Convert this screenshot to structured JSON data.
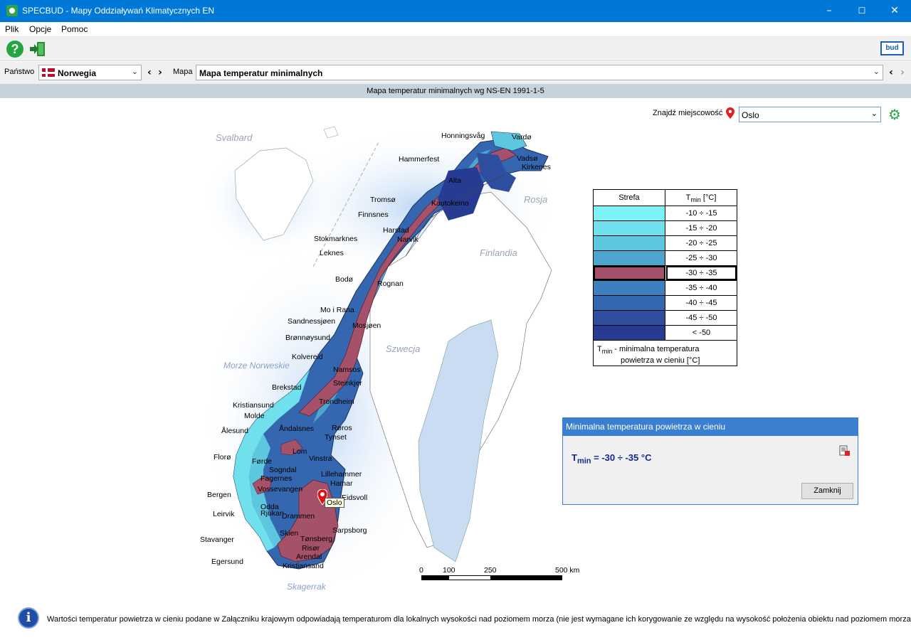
{
  "window": {
    "title": "SPECBUD - Mapy Oddziaływań Klimatycznych EN",
    "minimize": "–",
    "maximize": "☐",
    "close": "✕"
  },
  "menu": [
    "Plik",
    "Opcje",
    "Pomoc"
  ],
  "toolbar": {
    "help": "?",
    "logo": "bud"
  },
  "selection": {
    "country_label": "Państwo",
    "country_value": "Norwegia",
    "map_label": "Mapa",
    "map_value": "Mapa temperatur minimalnych",
    "prev": "‹",
    "next": "›"
  },
  "caption": "Mapa temperatur minimalnych wg NS-EN 1991-1-5",
  "find": {
    "label": "Znajdź miejscowość",
    "value": "Oslo"
  },
  "regions": {
    "svalbard": "Svalbard",
    "rosja": "Rosja",
    "finlandia": "Finlandia",
    "szwecja": "Szwecja",
    "morze": "Morze Norweskie",
    "skagerrak": "Skagerrak"
  },
  "cities": {
    "honningsvag": "Honningsvåg",
    "vardo": "Vardø",
    "hammerfest": "Hammerfest",
    "vadso": "Vadsø",
    "kirkenes": "Kirkenes",
    "alta": "Alta",
    "tromso": "Tromsø",
    "kautokeino": "Kautokeino",
    "finnsnes": "Finnsnes",
    "harstad": "Harstad",
    "stokmarknes": "Stokmarknes",
    "narvik": "Narvik",
    "leknes": "Leknes",
    "bodo": "Bodø",
    "rognan": "Rognan",
    "moirana": "Mo i Rana",
    "sandnessjoen": "Sandnessjøen",
    "mosjoen": "Mosjøen",
    "bronnoysund": "Brønnøysund",
    "kolvereid": "Kolvereid",
    "namsos": "Namsos",
    "brekstad": "Brekstad",
    "steinkjer": "Steinkjer",
    "trondheim": "Trondheim",
    "kristiansund": "Kristiansund",
    "molde": "Molde",
    "roros": "Røros",
    "alesund": "Ålesund",
    "andalsnes": "Åndalsnes",
    "tynset": "Tynset",
    "lom": "Lom",
    "floro": "Florø",
    "forde": "Førde",
    "vinstra": "Vinstra",
    "sogndal": "Sogndal",
    "fagernes": "Fagernes",
    "lillehammer": "Lillehammer",
    "hamar": "Hamar",
    "bergen": "Bergen",
    "vossevangen": "Vossevangen",
    "eidsvoll": "Eidsvoll",
    "odda": "Odda",
    "rjukan": "Rjukan",
    "leirvik": "Leirvik",
    "drammen": "Drammen",
    "skien": "Skien",
    "sarpsborg": "Sarpsborg",
    "stavanger": "Stavanger",
    "tonsberg": "Tønsberg",
    "risor": "Risør",
    "arendal": "Arendal",
    "egersund": "Egersund",
    "kristiansand": "Kristiansand",
    "oslo": "Oslo"
  },
  "scale": [
    "0",
    "100",
    "250",
    "500 km"
  ],
  "legend": {
    "col1": "Strefa",
    "col2_main": "T",
    "col2_sub": "min",
    "col2_unit": " [°C]",
    "rows": [
      {
        "range": "-10 ÷ -15",
        "color": "#7ef3f7"
      },
      {
        "range": "-15 ÷ -20",
        "color": "#6fe0ec"
      },
      {
        "range": "-20 ÷ -25",
        "color": "#5dc7df"
      },
      {
        "range": "-25 ÷ -30",
        "color": "#4da6cf"
      },
      {
        "range": "-30 ÷ -35",
        "color": "#a6516a",
        "selected": true
      },
      {
        "range": "-35 ÷ -40",
        "color": "#3d7fbf"
      },
      {
        "range": "-40 ÷ -45",
        "color": "#3567b0"
      },
      {
        "range": "-45 ÷ -50",
        "color": "#2e4fa0"
      },
      {
        "range": "< -50",
        "color": "#283b92"
      }
    ],
    "note_t": "T",
    "note_sub": "min",
    "note_line1": " - minimalna temperatura",
    "note_line2": "powietrza w cieniu [°C]"
  },
  "panel": {
    "title": "Minimalna temperatura powietrza w cieniu",
    "value_t": "T",
    "value_sub": "min",
    "value_text": " = -30 ÷ -35 °C",
    "close": "Zamknij"
  },
  "footer": {
    "info": "i",
    "text": "Wartości temperatur powietrza w cieniu podane w Załączniku krajowym odpowiadają temperaturom dla lokalnych wysokości nad poziomem morza (nie jest wymagane ich korygowanie ze względu na wysokość położenia obiektu nad poziomem morza)."
  }
}
